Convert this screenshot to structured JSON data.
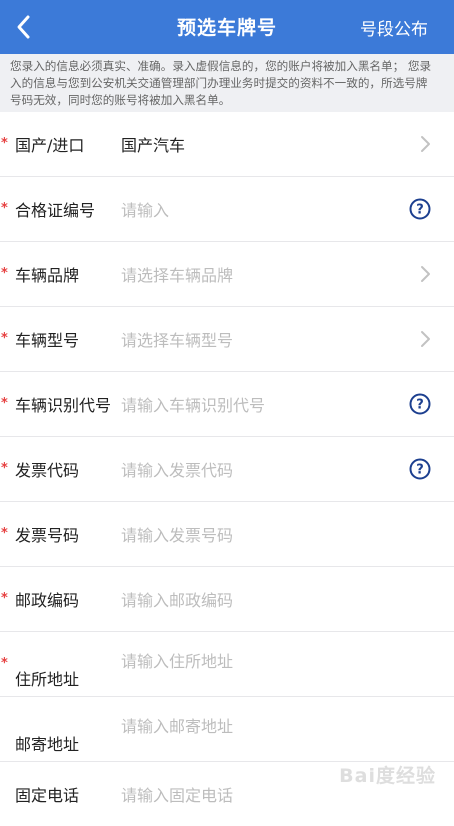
{
  "nav": {
    "back_icon": "chevron-left-icon",
    "title": "预选车牌号",
    "right_link": "号段公布",
    "background": "#3c7ad8"
  },
  "notice": {
    "text": "您录入的信息必须真实、准确。录入虚假信息的，您的账户将被加入黑名单； 您录入的信息与您到公安机关交通管理部门办理业务时提交的资料不一致的，所选号牌号码无效，同时您的账号将被加入黑名单。"
  },
  "form": {
    "rows": [
      {
        "label": "国产/进口",
        "value": "国产汽车",
        "placeholder": "",
        "required": "*",
        "icon": "chevron-right-icon"
      },
      {
        "label": "合格证编号",
        "value": "",
        "placeholder": "请输入",
        "required": "*",
        "icon": "help-icon"
      },
      {
        "label": "车辆品牌",
        "value": "",
        "placeholder": "请选择车辆品牌",
        "required": "*",
        "icon": "chevron-right-icon"
      },
      {
        "label": "车辆型号",
        "value": "",
        "placeholder": "请选择车辆型号",
        "required": "*",
        "icon": "chevron-right-icon"
      },
      {
        "label": "车辆识别代号",
        "value": "",
        "placeholder": "请输入车辆识别代号",
        "required": "*",
        "icon": "help-icon"
      },
      {
        "label": "发票代码",
        "value": "",
        "placeholder": "请输入发票代码",
        "required": "*",
        "icon": "help-icon"
      },
      {
        "label": "发票号码",
        "value": "",
        "placeholder": "请输入发票号码",
        "required": "*",
        "icon": ""
      },
      {
        "label": "邮政编码",
        "value": "",
        "placeholder": "请输入邮政编码",
        "required": "*",
        "icon": ""
      },
      {
        "label": "住所地址",
        "value": "",
        "placeholder": "请输入住所地址",
        "required": "*",
        "icon": ""
      },
      {
        "label": "邮寄地址",
        "value": "",
        "placeholder": "请输入邮寄地址",
        "required": "",
        "icon": ""
      },
      {
        "label": "固定电话",
        "value": "",
        "placeholder": "请输入固定电话",
        "required": "",
        "icon": ""
      }
    ]
  },
  "watermark": "Bai度经验",
  "colors": {
    "accent": "#3c7ad8",
    "required": "#e64040",
    "placeholder": "#bdbdbd"
  }
}
